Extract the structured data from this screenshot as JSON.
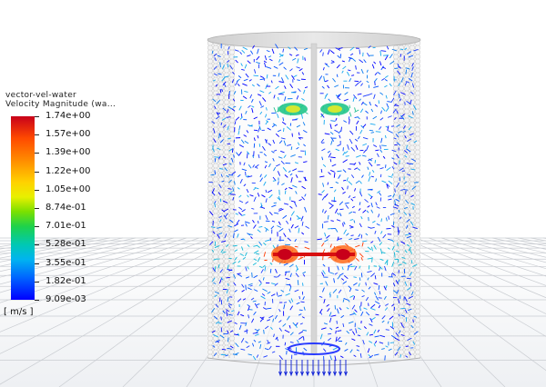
{
  "legend": {
    "title_line1": "vector-vel-water",
    "title_line2": "Velocity Magnitude (wa...",
    "units": "[ m/s ]",
    "ticks": [
      "1.74e+00",
      "1.57e+00",
      "1.39e+00",
      "1.22e+00",
      "1.05e+00",
      "8.74e-01",
      "7.01e-01",
      "5.28e-01",
      "3.55e-01",
      "1.82e-01",
      "9.09e-03"
    ]
  },
  "colors": {
    "high": "#c8001a",
    "mid": "#7ae000",
    "low": "#0000ff",
    "mesh": "#b8b8b8"
  }
}
